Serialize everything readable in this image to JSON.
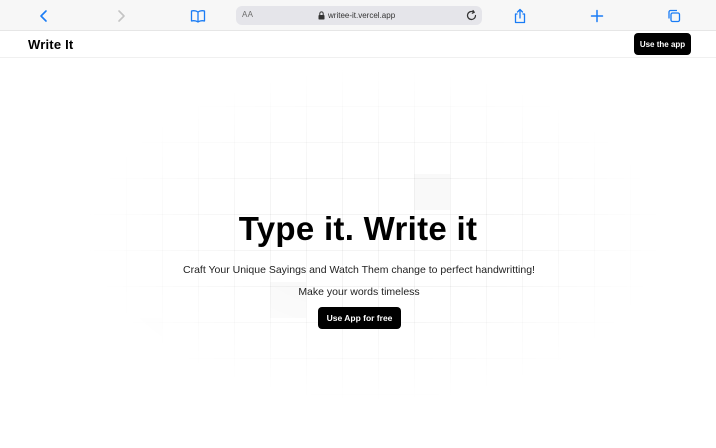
{
  "browser": {
    "text_size_label": "AA",
    "url": "writee-it.vercel.app",
    "accent": "#1a7cf5"
  },
  "header": {
    "brand": "Write It",
    "cta_label": "Use the app"
  },
  "hero": {
    "title": "Type it. Write it",
    "subtitle": "Craft Your Unique Sayings and Watch Them change to perfect handwritting!",
    "tagline": "Make your words timeless",
    "cta_label": "Use App for free"
  },
  "icons": {
    "back": "chevron-left-icon",
    "forward": "chevron-right-icon",
    "bookmarks": "book-icon",
    "lock": "lock-icon",
    "reload": "reload-icon",
    "share": "share-icon",
    "new_tab": "plus-icon",
    "tabs": "tabs-icon"
  },
  "colors": {
    "button_bg": "#000000",
    "button_text": "#ffffff",
    "toolbar_bg": "#f7f7f7"
  }
}
